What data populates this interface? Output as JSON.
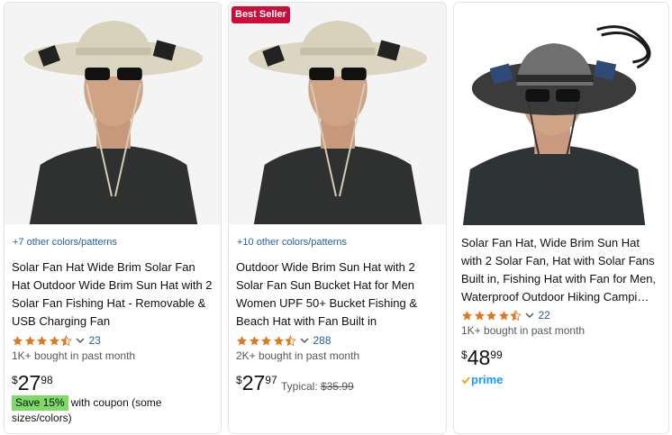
{
  "products": [
    {
      "badge": "",
      "colors_link": "+7 other colors/patterns",
      "title": "Solar Fan Hat Wide Brim Solar Fan Hat Outdoor Wide Brim Sun Hat with 2 Solar Fan Fishing Hat - Removable & USB Charging Fan",
      "rating": 4.5,
      "review_count": "23",
      "bought": "1K+ bought in past month",
      "price_symbol": "$",
      "price_whole": "27",
      "price_fraction": "98",
      "coupon_badge": "Save 15%",
      "coupon_text": "with coupon (some sizes/colors)"
    },
    {
      "badge": "Best Seller",
      "colors_link": "+10 other colors/patterns",
      "title": "Outdoor Wide Brim Sun Hat with 2 Solar Fan Sun Bucket Hat for Men Women UPF 50+ Bucket Fishing & Beach Hat with Fan Built in",
      "rating": 4.5,
      "review_count": "288",
      "bought": "2K+ bought in past month",
      "price_symbol": "$",
      "price_whole": "27",
      "price_fraction": "97",
      "typical_label": "Typical:",
      "typical_price": "$35.99"
    },
    {
      "title": "Solar Fan Hat, Wide Brim Sun Hat with 2 Solar Fan, Hat with Solar Fans Built in, Fishing Hat with Fan for Men, Waterproof Outdoor Hiking Campi…",
      "rating": 4.5,
      "review_count": "22",
      "bought": "1K+ bought in past month",
      "price_symbol": "$",
      "price_whole": "48",
      "price_fraction": "99",
      "prime_label": "prime"
    }
  ],
  "colors": {
    "star": "#de7921",
    "link": "#2162a1",
    "badge": "#cc0c39",
    "coupon": "#7fda69",
    "prime": "#1399ff"
  },
  "icons": {
    "star": "star-icon",
    "half_star": "half-star-icon",
    "chevron": "chevron-down-icon",
    "prime_check": "prime-check-icon"
  }
}
